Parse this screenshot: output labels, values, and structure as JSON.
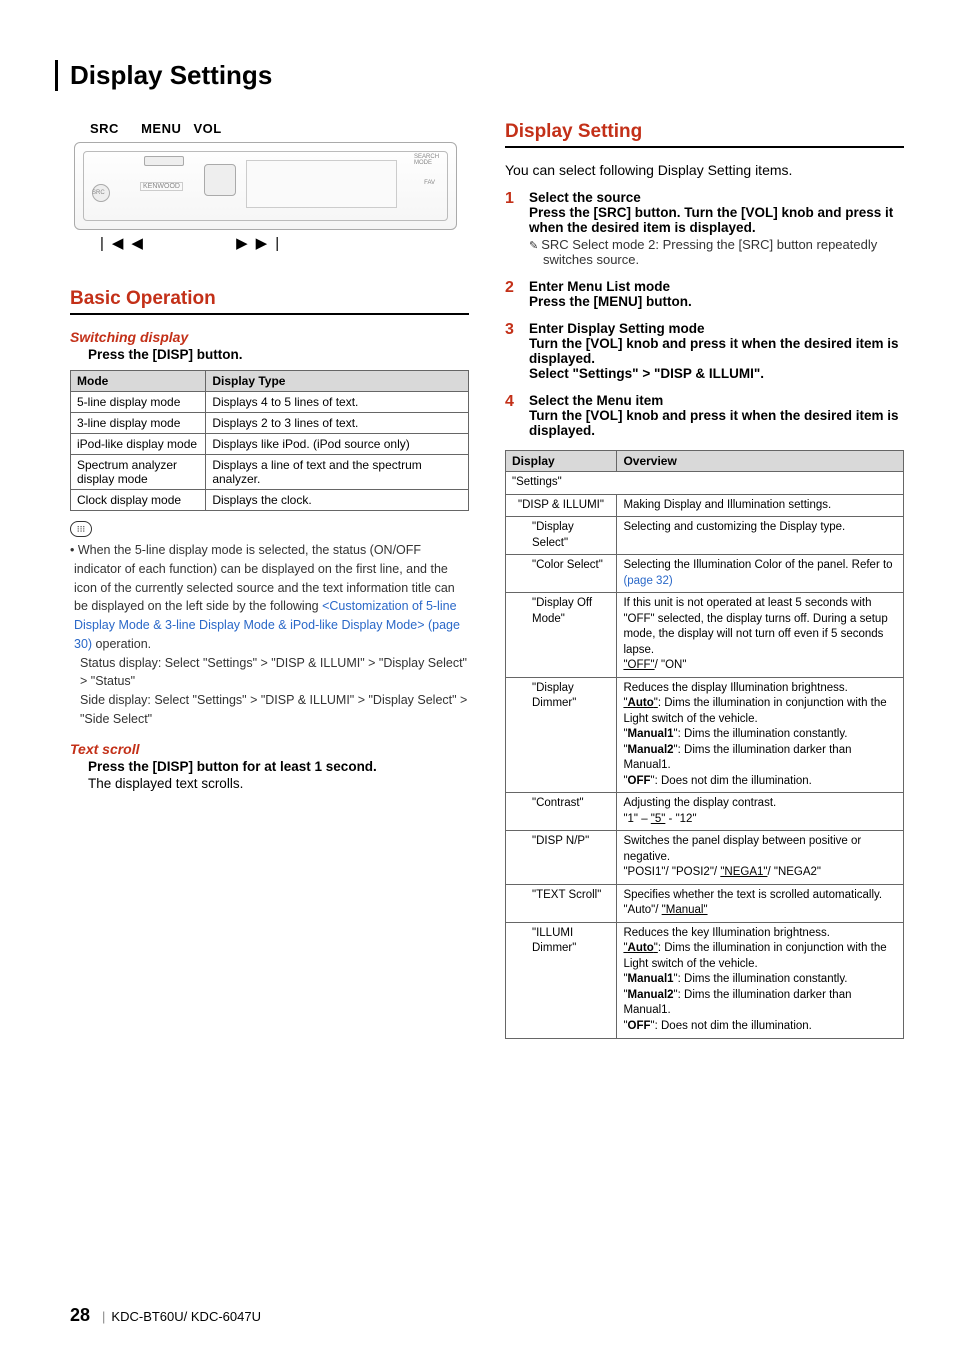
{
  "page": {
    "title": "Display Settings",
    "number": "28",
    "model": "KDC-BT60U/ KDC-6047U"
  },
  "left": {
    "labels": {
      "src": "SRC",
      "menu": "MENU",
      "vol": "VOL"
    },
    "section": "Basic Operation",
    "switching": {
      "head": "Switching display",
      "instr": "Press the [DISP] button."
    },
    "table": {
      "th1": "Mode",
      "th2": "Display Type",
      "rows": [
        {
          "m": "5-line display mode",
          "d": "Displays 4 to 5 lines of text."
        },
        {
          "m": "3-line display mode",
          "d": "Displays 2 to 3 lines of text."
        },
        {
          "m": "iPod-like display mode",
          "d": "Displays like iPod. (iPod source only)"
        },
        {
          "m": "Spectrum analyzer display mode",
          "d": "Displays a line of text and the spectrum analyzer."
        },
        {
          "m": "Clock display mode",
          "d": "Displays the clock."
        }
      ]
    },
    "note1a": "• When the 5-line display mode is selected, the status (ON/OFF indicator of each function) can be displayed on the first line, and the icon of the currently selected source and the text information title can be displayed on the left side by the following ",
    "note1link": "<Customization of 5-line Display Mode & 3-line Display Mode & iPod-like Display Mode> (page 30)",
    "note1b": " operation.",
    "note2a": "Status display: Select \"Settings\" > \"DISP & ILLUMI\" > \"Display Select\" > \"Status\"",
    "note2b": "Side display: Select \"Settings\" > \"DISP & ILLUMI\" > \"Display Select\" > \"Side Select\"",
    "textscroll": {
      "head": "Text scroll",
      "instr": "Press the [DISP] button for at least 1 second.",
      "body": "The displayed text scrolls."
    }
  },
  "right": {
    "section": "Display Setting",
    "intro": "You can select following Display Setting items.",
    "steps": [
      {
        "n": "1",
        "title": "Select the source",
        "bold": "Press the [SRC] button. Turn the [VOL] knob and press it when the desired item is displayed.",
        "sub": "SRC Select mode 2: Pressing the [SRC] button repeatedly switches source."
      },
      {
        "n": "2",
        "title": "Enter Menu List mode",
        "bold": "Press the [MENU] button."
      },
      {
        "n": "3",
        "title": "Enter Display Setting mode",
        "bold": "Turn the [VOL] knob and press it when the desired item is displayed.",
        "bold2a": "Select \"Settings\" ",
        "bold2b": " \"DISP & ILLUMI\"."
      },
      {
        "n": "4",
        "title": "Select the Menu item",
        "bold": "Turn the [VOL] knob and press it when the desired item is displayed."
      }
    ],
    "menu": {
      "th1": "Display",
      "th2": "Overview",
      "settings": "\"Settings\"",
      "rows": [
        {
          "d": "\"DISP & ILLUMI\"",
          "indent": 1,
          "o": "Making Display and Illumination settings."
        },
        {
          "d": "\"Display Select\"",
          "indent": 2,
          "o": "Selecting and customizing the Display type."
        },
        {
          "d": "\"Color Select\"",
          "indent": 2,
          "o": "Selecting the Illumination Color of the panel. Refer to <link><Illumination Color Selection> (page 32)</link>"
        },
        {
          "d": "\"Display Off Mode\"",
          "indent": 2,
          "o": "If this unit is not operated at least 5 seconds with \"OFF\" selected, the display turns off. During a setup mode, the display will not turn off even if 5 seconds lapse.<br><def>\"OFF\"</def>/ \"ON\""
        },
        {
          "d": "\"Display Dimmer\"",
          "indent": 2,
          "o": "Reduces the display Illumination brightness.<br><def>\"<b>Auto</b>\"</def>: Dims the illumination in conjunction with the Light switch of the vehicle.<br>\"<b>Manual1</b>\": Dims the illumination constantly.<br>\"<b>Manual2</b>\": Dims the illumination darker than Manual1.<br>\"<b>OFF</b>\": Does not dim the illumination."
        },
        {
          "d": "\"Contrast\"",
          "indent": 2,
          "o": "Adjusting the display contrast.<br>\"1\" – <def>\"5\"</def> - \"12\""
        },
        {
          "d": "\"DISP N/P\"",
          "indent": 2,
          "o": "Switches the panel display between positive or negative.<br>\"POSI1\"/ \"POSI2\"/ <def>\"NEGA1\"</def>/ \"NEGA2\""
        },
        {
          "d": "\"TEXT Scroll\"",
          "indent": 2,
          "o": "Specifies whether the text is scrolled automatically.<br>\"Auto\"/ <def>\"Manual\"</def>"
        },
        {
          "d": "\"ILLUMI Dimmer\"",
          "indent": 2,
          "o": "Reduces the key Illumination brightness.<br><def>\"<b>Auto</b>\"</def>: Dims the illumination in conjunction with the Light switch of the vehicle.<br>\"<b>Manual1</b>\": Dims the illumination constantly.<br>\"<b>Manual2</b>\": Dims the illumination darker than Manual1.<br>\"<b>OFF</b>\": Does not dim the illumination."
        }
      ]
    }
  }
}
